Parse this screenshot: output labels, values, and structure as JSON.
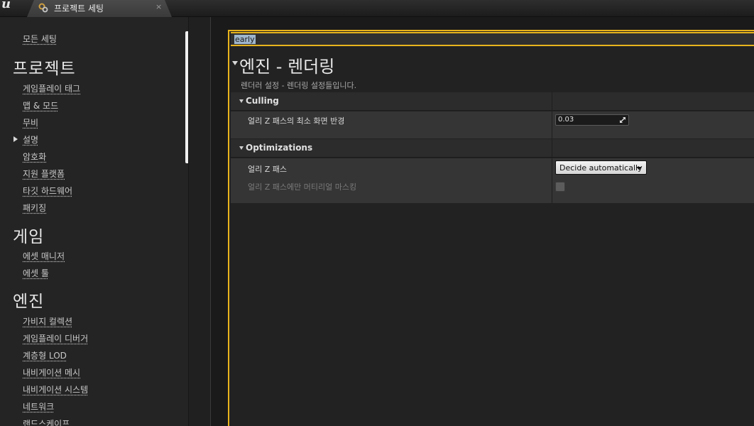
{
  "window": {
    "tab_title": "프로젝트 세팅",
    "tab_close": "×",
    "logo_icon": "unreal-logo-icon"
  },
  "sidebar": {
    "top_item": "모든 세팅",
    "sections": [
      {
        "title": "프로젝트",
        "items": [
          "게임플레이 태그",
          "맵 & 모드",
          "무비",
          "설명",
          "암호화",
          "지원 플랫폼",
          "타깃 하드웨어",
          "패키징"
        ]
      },
      {
        "title": "게임",
        "items": [
          "에셋 매니저",
          "에셋 툴"
        ]
      },
      {
        "title": "엔진",
        "items": [
          "가비지 컬렉션",
          "게임플레이 디버거",
          "계층형 LOD",
          "내비게이션 메시",
          "내비게이션 시스템",
          "네트워크",
          "랜드스케이프"
        ]
      }
    ]
  },
  "search": {
    "value": "early"
  },
  "category": {
    "title": "엔진 - 렌더링",
    "description": "렌더러 설정 - 렌더링 설정들입니다."
  },
  "groups": {
    "culling": {
      "label": "Culling",
      "properties": [
        {
          "name": "얼리 Z 패스의 최소 화면 반경",
          "value": "0.03"
        }
      ]
    },
    "optimizations": {
      "label": "Optimizations",
      "properties": [
        {
          "name": "얼리 Z 패스",
          "value": "Decide automatically"
        },
        {
          "name": "얼리 Z 패스에만 머티리얼 마스킹",
          "checked": false
        }
      ]
    }
  },
  "colors": {
    "accent": "#e8b41c",
    "selection": "#9fb6cc"
  }
}
